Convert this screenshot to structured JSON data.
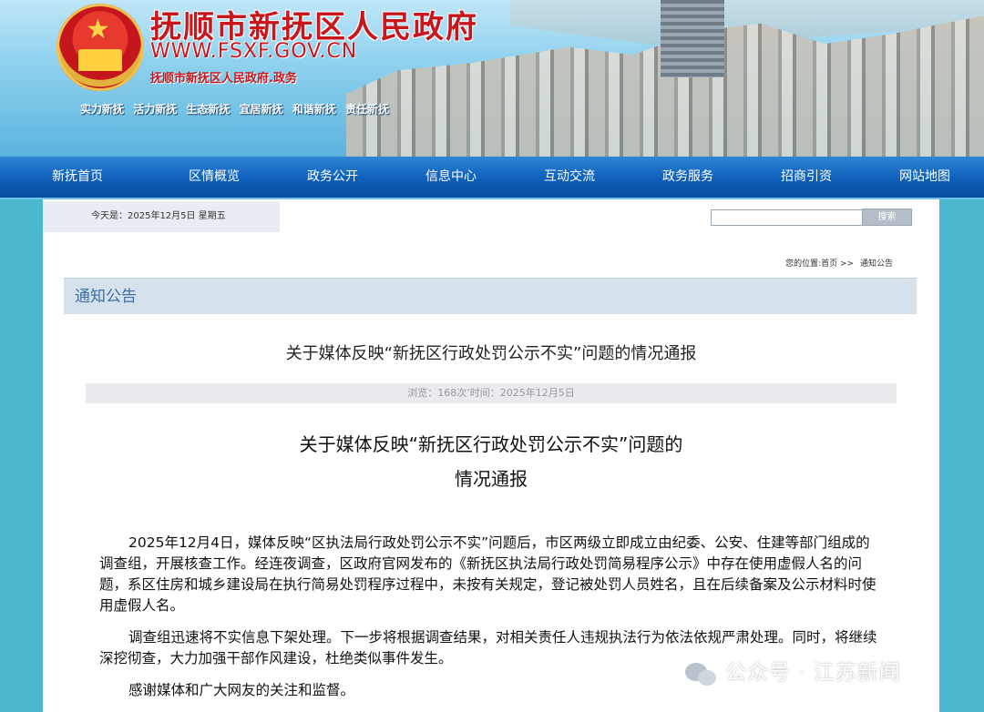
{
  "banner": {
    "title": "抚顺市新抚区人民政府",
    "url": "WWW.FSXF.GOV.CN",
    "subtitle": "抚顺市新抚区人民政府.政务",
    "slogans": [
      "实力新抚",
      "活力新抚",
      "生态新抚",
      "宜居新抚",
      "和谐新抚",
      "责任新抚"
    ]
  },
  "nav": {
    "items": [
      "新抚首页",
      "区情概览",
      "政务公开",
      "信息中心",
      "互动交流",
      "政务服务",
      "招商引资",
      "网站地图"
    ]
  },
  "topbar": {
    "date": "今天是：2025年12月5日 星期五",
    "search_button": "搜索",
    "search_value": ""
  },
  "breadcrumb": {
    "prefix": "您的位置:首页 >>",
    "current": "通知公告"
  },
  "section": {
    "title": "通知公告"
  },
  "article": {
    "title": "关于媒体反映“新抚区行政处罚公示不实”问题的情况通报",
    "meta": "浏览：168次’时间：2025年12月5日",
    "heading_line1": "关于媒体反映“新抚区行政处罚公示不实”问题的",
    "heading_line2": "情况通报",
    "paragraphs": [
      "2025年12月4日，媒体反映“区执法局行政处罚公示不实”问题后，市区两级立即成立由纪委、公安、住建等部门组成的调查组，开展核查工作。经连夜调查，区政府官网发布的《新抚区执法局行政处罚简易程序公示》中存在使用虚假人名的问题，系区住房和城乡建设局在执行简易处罚程序过程中，未按有关规定，登记被处罚人员姓名，且在后续备案及公示材料时使用虚假人名。",
      "调查组迅速将不实信息下架处理。下一步将根据调查结果，对相关责任人违规执法行为依法依规严肃处理。同时，将继续深挖彻查，大力加强干部作风建设，杜绝类似事件发生。",
      "感谢媒体和广大网友的关注和监督。"
    ]
  },
  "watermark": {
    "text": "公众号 · 江苏新闻",
    "icon": "wechat-icon"
  },
  "colors": {
    "nav": "#0e5fb9",
    "title_red": "#c8161d",
    "section_text": "#3a6fa8",
    "section_bg": "#d5e2ec"
  }
}
